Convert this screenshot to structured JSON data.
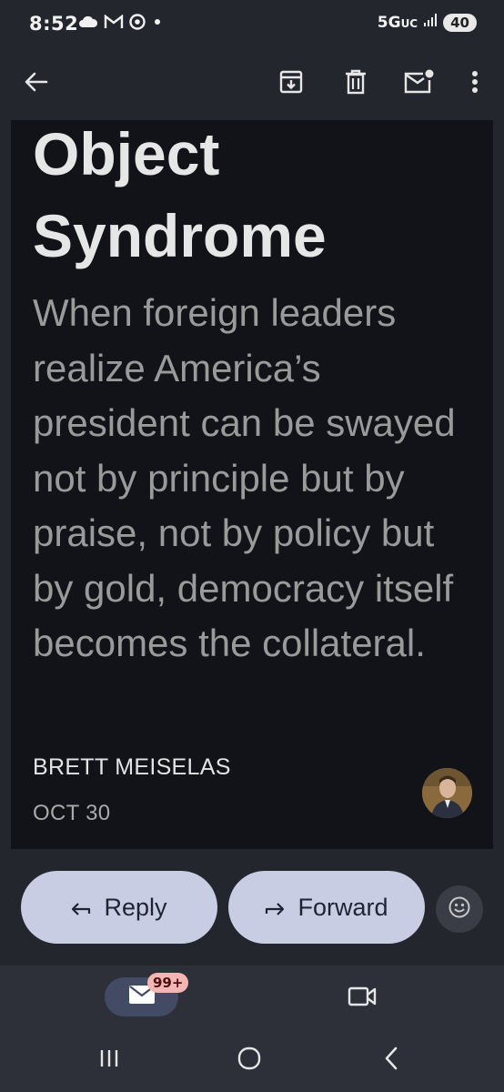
{
  "status_bar": {
    "time": "8:52",
    "network": "5G",
    "network_suffix": "UC",
    "battery": "40",
    "icons": [
      "cloud-icon",
      "gmail-icon",
      "chrome-icon",
      "dot-icon",
      "signal-icon"
    ]
  },
  "toolbar": {
    "icons": [
      "back-arrow-icon",
      "archive-icon",
      "delete-icon",
      "mark-unread-icon",
      "more-vert-icon"
    ]
  },
  "article": {
    "title_line1": "Object",
    "title_line2": "Syndrome",
    "subtitle": "When foreign leaders realize America’s president can be swayed not by principle but by praise, not by policy but by gold, democracy itself becomes the collateral.",
    "author": "BRETT MEISELAS",
    "date": "OCT 30"
  },
  "actions": {
    "reply_label": "Reply",
    "forward_label": "Forward",
    "emoji_icon": "emoji-smile-icon"
  },
  "bottom_nav": {
    "mail_badge": "99+",
    "icons": [
      "mail-icon",
      "video-icon"
    ]
  },
  "system_nav": {
    "icons": [
      "recent-apps-icon",
      "home-icon",
      "back-icon"
    ]
  },
  "colors": {
    "background": "#23262d",
    "content_bg": "#121318",
    "pill_bg": "#c9cde3",
    "badge_bg": "#f4b6b2"
  }
}
